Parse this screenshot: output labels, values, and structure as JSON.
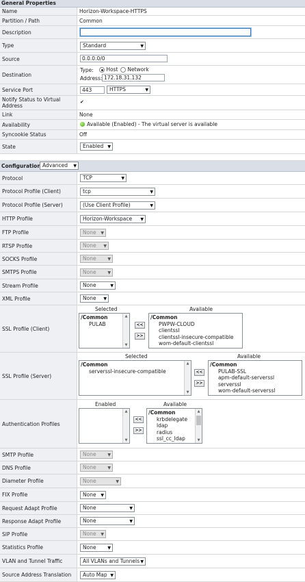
{
  "general": {
    "header": "General Properties",
    "rows": {
      "name": {
        "label": "Name",
        "value": "Horizon-Workspace-HTTPS"
      },
      "partition": {
        "label": "Partition / Path",
        "value": "Common"
      },
      "description": {
        "label": "Description",
        "value": ""
      },
      "type": {
        "label": "Type",
        "value": "Standard"
      },
      "source": {
        "label": "Source",
        "value": "0.0.0.0/0"
      },
      "destination": {
        "label": "Destination",
        "type_caption": "Type:",
        "opt_host": "Host",
        "opt_network": "Network",
        "address_caption": "Address:",
        "address": "172.18.31.132"
      },
      "service_port": {
        "label": "Service Port",
        "port": "443",
        "protocol": "HTTPS"
      },
      "notify": {
        "label": "Notify Status to Virtual Address"
      },
      "link": {
        "label": "Link",
        "value": "None"
      },
      "availability": {
        "label": "Availability",
        "value": "Available (Enabled) - The virtual server is available"
      },
      "syncookie": {
        "label": "Syncookie Status",
        "value": "Off"
      },
      "state": {
        "label": "State",
        "value": "Enabled"
      }
    }
  },
  "configuration": {
    "header": "Configuration:",
    "mode": "Advanced",
    "protocol": {
      "label": "Protocol",
      "value": "TCP"
    },
    "pp_client": {
      "label": "Protocol Profile (Client)",
      "value": "tcp"
    },
    "pp_server": {
      "label": "Protocol Profile (Server)",
      "value": "(Use Client Profile)"
    },
    "http": {
      "label": "HTTP Profile",
      "value": "Horizon-Workspace"
    },
    "ftp": {
      "label": "FTP Profile",
      "value": "None"
    },
    "rtsp": {
      "label": "RTSP Profile",
      "value": "None"
    },
    "socks": {
      "label": "SOCKS Profile",
      "value": "None"
    },
    "smtps": {
      "label": "SMTPS Profile",
      "value": "None"
    },
    "stream": {
      "label": "Stream Profile",
      "value": "None"
    },
    "xml": {
      "label": "XML Profile",
      "value": "None"
    },
    "ssl_client": {
      "label": "SSL Profile (Client)",
      "selected_caption": "Selected",
      "available_caption": "Available",
      "selected_group": "/Common",
      "selected": [
        "PULAB"
      ],
      "available_group": "/Common",
      "available": [
        "PWPW-CLOUD",
        "clientssl",
        "clientssl-insecure-compatible",
        "wom-default-clientssl"
      ]
    },
    "ssl_server": {
      "label": "SSL Profile (Server)",
      "selected_caption": "Selected",
      "available_caption": "Available",
      "selected_group": "/Common",
      "selected": [
        "serverssl-insecure-compatible"
      ],
      "available_group": "/Common",
      "available": [
        "PULAB-SSL",
        "apm-default-serverssl",
        "serverssl",
        "wom-default-serverssl"
      ]
    },
    "auth": {
      "label": "Authentication Profiles",
      "enabled_caption": "Enabled",
      "available_caption": "Available",
      "available_group": "/Common",
      "available": [
        "krbdelegate",
        "ldap",
        "radius",
        "ssl_cc_ldap"
      ]
    },
    "move_left": "<<",
    "move_right": ">>",
    "smtp": {
      "label": "SMTP Profile",
      "value": "None"
    },
    "dns": {
      "label": "DNS Profile",
      "value": "None"
    },
    "diameter": {
      "label": "Diameter Profile",
      "value": "None"
    },
    "fix": {
      "label": "FIX Profile",
      "value": "None"
    },
    "req_adapt": {
      "label": "Request Adapt Profile",
      "value": "None"
    },
    "resp_adapt": {
      "label": "Response Adapt Profile",
      "value": "None"
    },
    "sip": {
      "label": "SIP Profile",
      "value": "None"
    },
    "stats": {
      "label": "Statistics Profile",
      "value": "None"
    },
    "vlan": {
      "label": "VLAN and Tunnel Traffic",
      "value": "All VLANs and Tunnels"
    },
    "snat": {
      "label": "Source Address Translation",
      "value": "Auto Map"
    }
  }
}
